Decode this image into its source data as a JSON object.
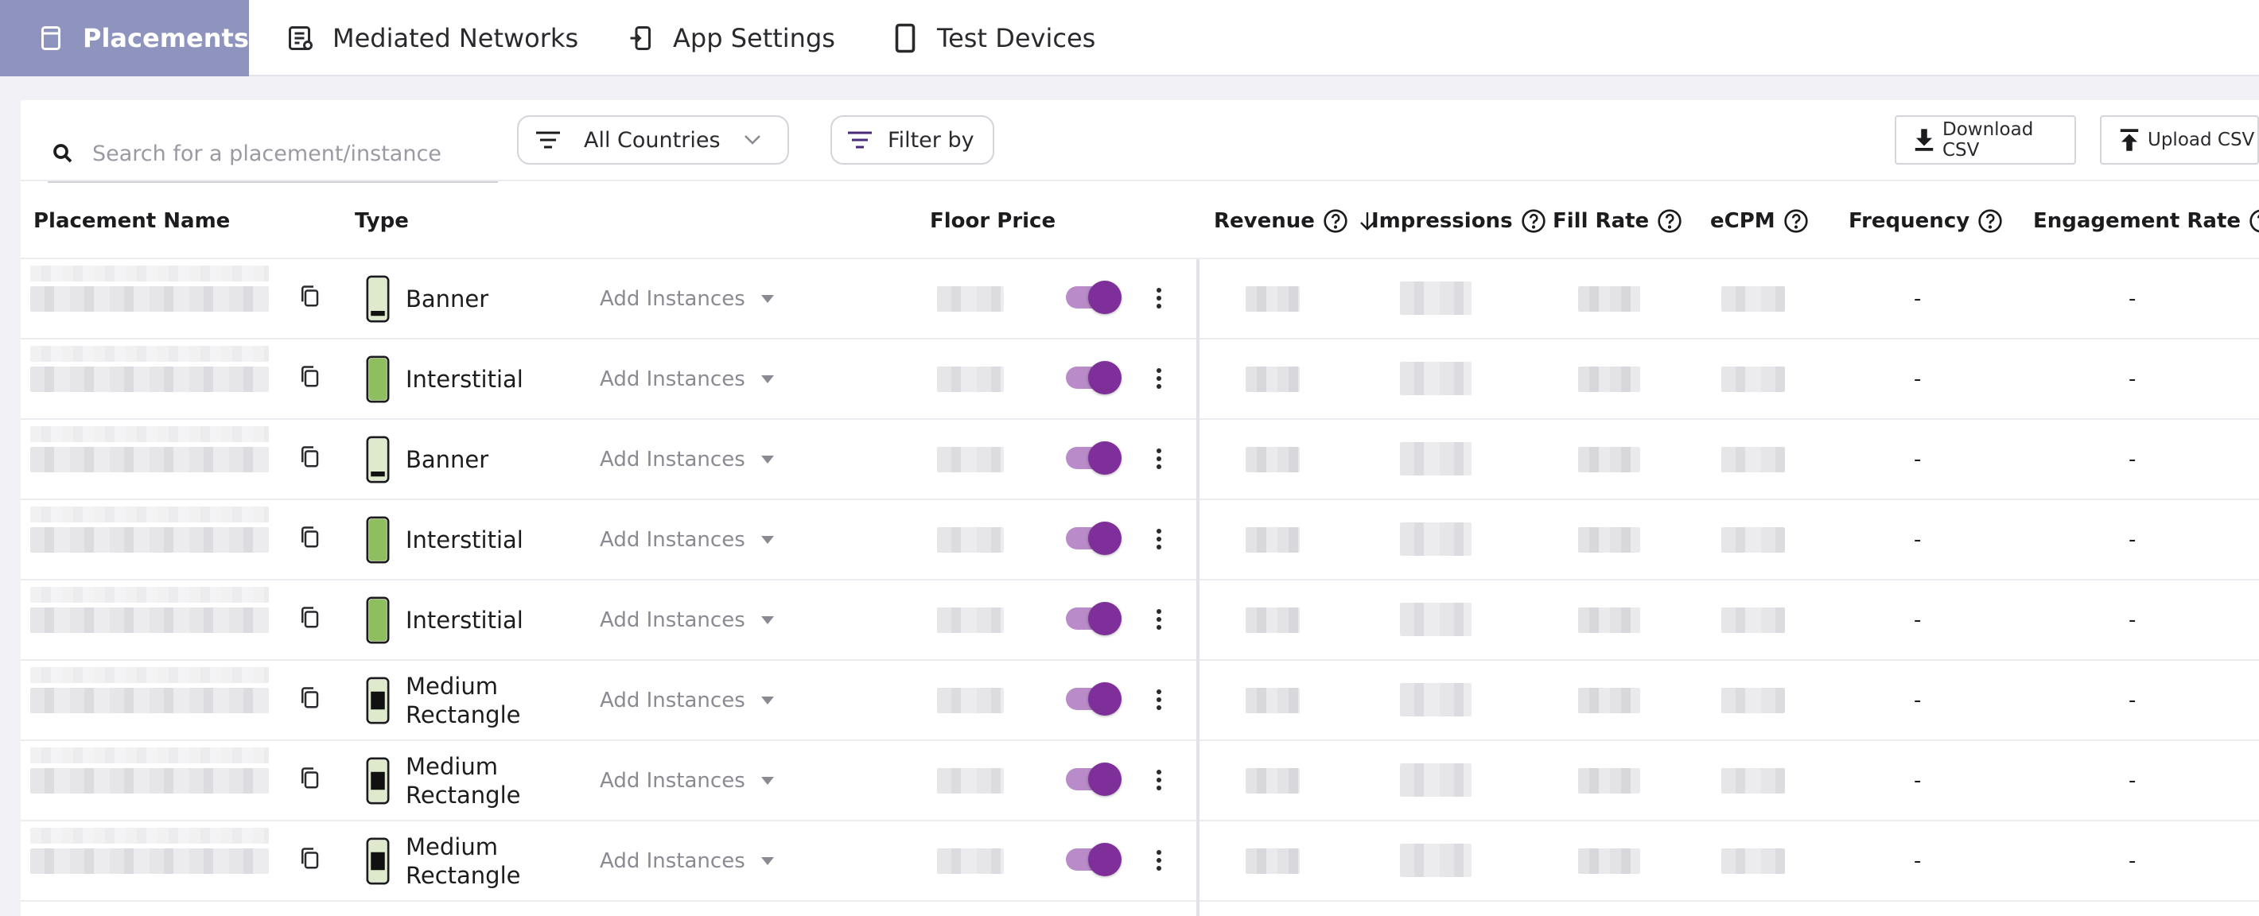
{
  "nav": {
    "tabs": [
      {
        "label": "Placements",
        "icon": "placement-icon",
        "active": true
      },
      {
        "label": "Mediated Networks",
        "icon": "networks-icon",
        "active": false
      },
      {
        "label": "App Settings",
        "icon": "app-settings-icon",
        "active": false
      },
      {
        "label": "Test Devices",
        "icon": "phone-icon",
        "active": false
      }
    ]
  },
  "toolbar": {
    "search_placeholder": "Search for a placement/instance",
    "countries_label": "All Countries",
    "filter_label": "Filter by",
    "download_label": "Download CSV",
    "upload_label": "Upload CSV"
  },
  "table": {
    "columns": {
      "placement_name": "Placement Name",
      "type": "Type",
      "floor_price": "Floor Price",
      "revenue": "Revenue",
      "impressions": "Impressions",
      "fill_rate": "Fill Rate",
      "ecpm": "eCPM",
      "frequency": "Frequency",
      "engagement_rate": "Engagement Rate"
    },
    "add_instances_label": "Add Instances",
    "rows": [
      {
        "type_line1": "Banner",
        "type_line2": "",
        "type": "banner",
        "enabled": true,
        "frequency": "-",
        "engagement_rate": "-"
      },
      {
        "type_line1": "Interstitial",
        "type_line2": "",
        "type": "interstitial",
        "enabled": true,
        "frequency": "-",
        "engagement_rate": "-"
      },
      {
        "type_line1": "Banner",
        "type_line2": "",
        "type": "banner",
        "enabled": true,
        "frequency": "-",
        "engagement_rate": "-"
      },
      {
        "type_line1": "Interstitial",
        "type_line2": "",
        "type": "interstitial",
        "enabled": true,
        "frequency": "-",
        "engagement_rate": "-"
      },
      {
        "type_line1": "Interstitial",
        "type_line2": "",
        "type": "interstitial",
        "enabled": true,
        "frequency": "-",
        "engagement_rate": "-"
      },
      {
        "type_line1": "Medium",
        "type_line2": "Rectangle",
        "type": "medium-rectangle",
        "enabled": true,
        "frequency": "-",
        "engagement_rate": "-"
      },
      {
        "type_line1": "Medium",
        "type_line2": "Rectangle",
        "type": "medium-rectangle",
        "enabled": true,
        "frequency": "-",
        "engagement_rate": "-"
      },
      {
        "type_line1": "Medium",
        "type_line2": "Rectangle",
        "type": "medium-rectangle",
        "enabled": true,
        "frequency": "-",
        "engagement_rate": "-"
      }
    ]
  },
  "colors": {
    "active_tab": "#8e94bd",
    "toggle_knob": "#7e2f9a",
    "toggle_track": "#b98bc8",
    "interstitial_screen": "#8fbe5e",
    "banner_screen": "#dfeacc"
  }
}
